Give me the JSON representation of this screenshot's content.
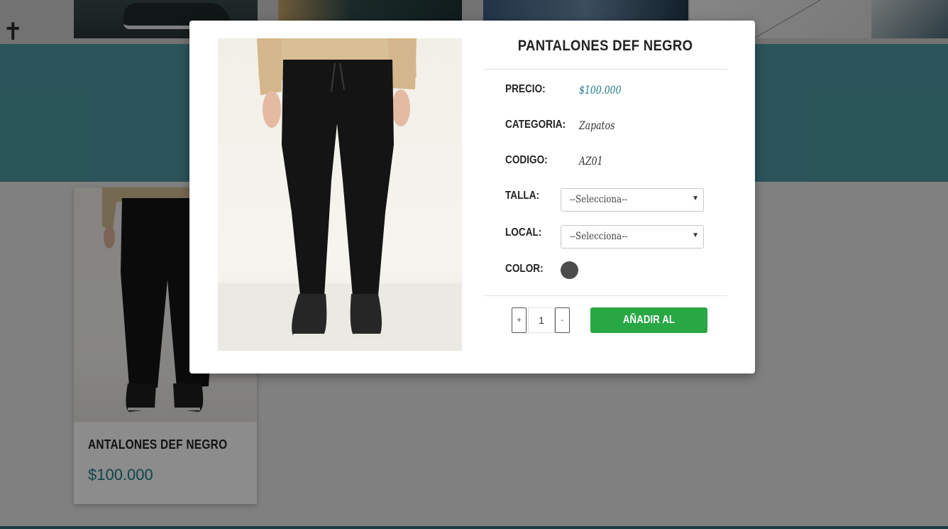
{
  "product": {
    "title": "PANTALONES DEF NEGRO",
    "fields": [
      {
        "label": "PRECIO:",
        "value": "$100.000"
      },
      {
        "label": "CATEGORIA:",
        "value": "Zapatos"
      },
      {
        "label": "CODIGO:",
        "value": "AZ01"
      }
    ],
    "talla": {
      "label": "TALLA:",
      "selected": "--Selecciona--"
    },
    "local": {
      "label": "LOCAL:",
      "selected": "--Selecciona--"
    },
    "color": {
      "label": "COLOR:",
      "swatch": "#4c4c4c"
    }
  },
  "cart": {
    "plus": "+",
    "minus": "-",
    "quantity": "1",
    "add_label": "AÑADIR AL CARRITO"
  },
  "card": {
    "title": "ANTALONES DEF NEGRO",
    "price": "$100.000"
  },
  "colors": {
    "accent": "#1d7b87",
    "banner": "#4d9aa3",
    "button": "#28a745"
  }
}
